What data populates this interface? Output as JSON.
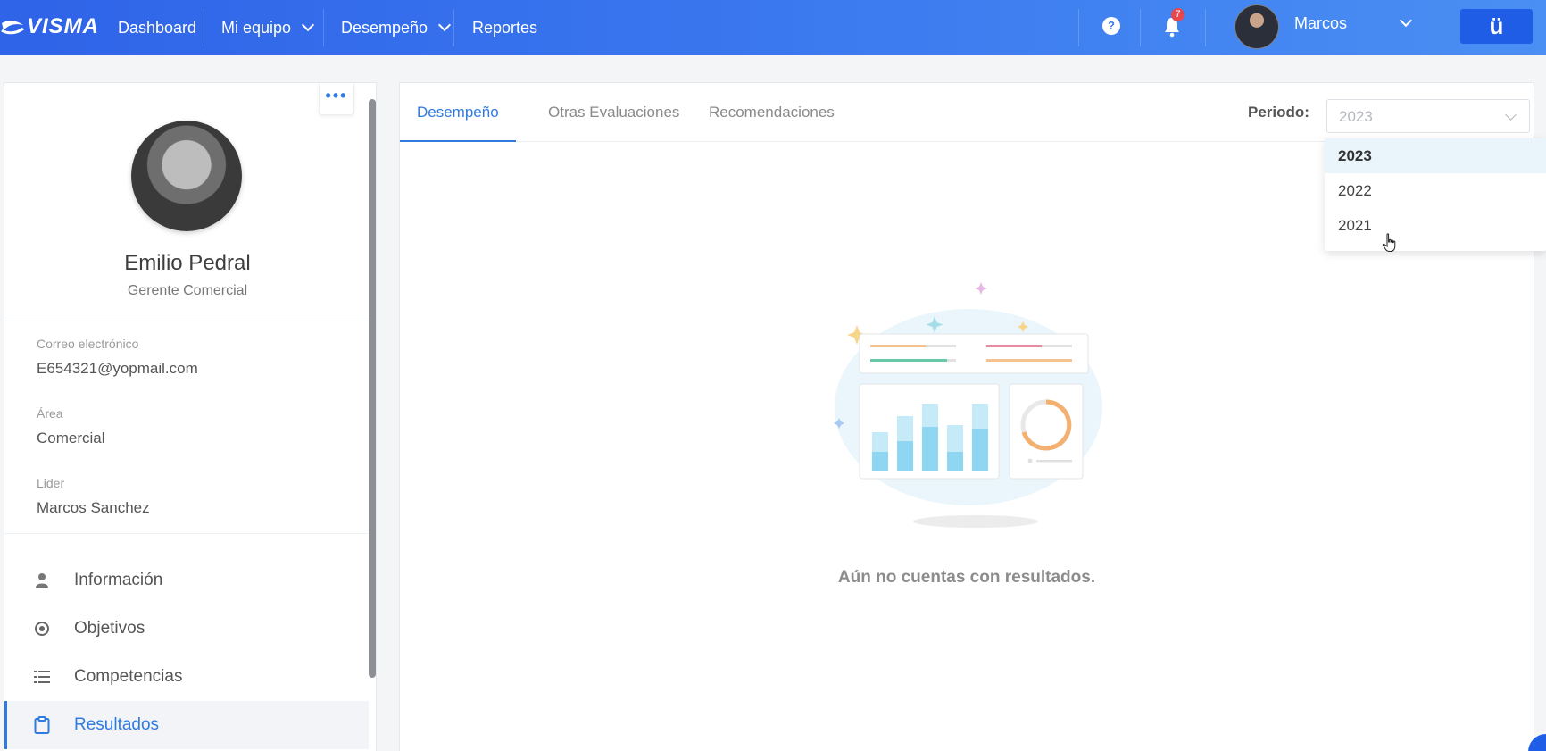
{
  "topbar": {
    "logo": "VISMA",
    "nav": [
      {
        "label": "Dashboard",
        "has_dropdown": false
      },
      {
        "label": "Mi equipo",
        "has_dropdown": true
      },
      {
        "label": "Desempeño",
        "has_dropdown": true
      },
      {
        "label": "Reportes",
        "has_dropdown": false
      }
    ],
    "help_icon": "?",
    "notification_count": "7",
    "user_name": "Marcos",
    "brand_button": "ü"
  },
  "profile": {
    "menu_more": "•••",
    "name": "Emilio Pedral",
    "role": "Gerente Comercial",
    "fields": [
      {
        "label": "Correo electrónico",
        "value": "E654321@yopmail.com"
      },
      {
        "label": "Área",
        "value": "Comercial"
      },
      {
        "label": "Lider",
        "value": "Marcos Sanchez"
      }
    ],
    "menu": [
      {
        "label": "Información",
        "icon": "user-icon",
        "active": false
      },
      {
        "label": "Objetivos",
        "icon": "target-icon",
        "active": false
      },
      {
        "label": "Competencias",
        "icon": "list-icon",
        "active": false
      },
      {
        "label": "Resultados",
        "icon": "clipboard-icon",
        "active": true
      }
    ]
  },
  "main": {
    "tabs": [
      {
        "label": "Desempeño",
        "active": true
      },
      {
        "label": "Otras Evaluaciones",
        "active": false
      },
      {
        "label": "Recomendaciones",
        "active": false
      }
    ],
    "period_label": "Periodo:",
    "period_value": "2023",
    "period_options": [
      "2023",
      "2022",
      "2021"
    ],
    "empty_message": "Aún no cuentas con resultados."
  },
  "colors": {
    "accent": "#2f7be0",
    "topbar_start": "#2f63e8",
    "topbar_end": "#4a8ff3"
  }
}
